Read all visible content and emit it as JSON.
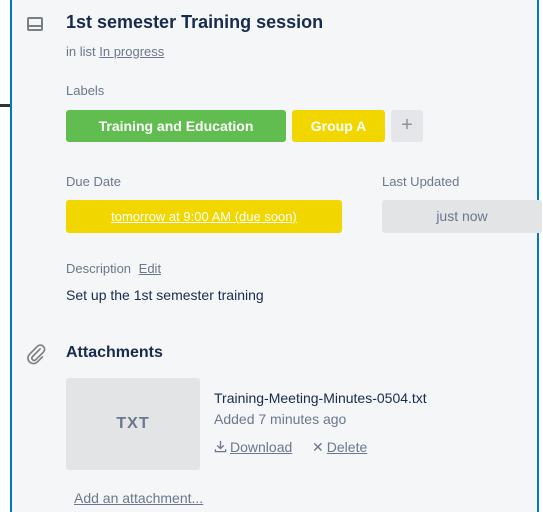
{
  "card": {
    "title": "1st semester Training session",
    "in_list_prefix": "in list",
    "list_name": "In progress"
  },
  "labels": {
    "heading": "Labels",
    "items": [
      {
        "text": "Training and Education",
        "color": "#61bd4f"
      },
      {
        "text": "Group A",
        "color": "#f2d600"
      }
    ],
    "add_label": "+"
  },
  "due_date": {
    "heading": "Due Date",
    "value": "tomorrow at 9:00 AM (due soon)",
    "color": "#f2d600"
  },
  "last_updated": {
    "heading": "Last Updated",
    "value": "just now"
  },
  "description": {
    "heading": "Description",
    "edit_label": "Edit",
    "text": "Set up the 1st semester training"
  },
  "attachments": {
    "heading": "Attachments",
    "items": [
      {
        "thumb_label": "TXT",
        "file_name": "Training-Meeting-Minutes-0504.txt",
        "added": "Added 7 minutes ago",
        "download_label": "Download",
        "delete_label": "Delete"
      }
    ],
    "add_label": "Add an attachment..."
  },
  "icons": {
    "card": "card-icon",
    "attachment": "paperclip-icon",
    "download": "download-icon",
    "delete": "close-icon"
  }
}
